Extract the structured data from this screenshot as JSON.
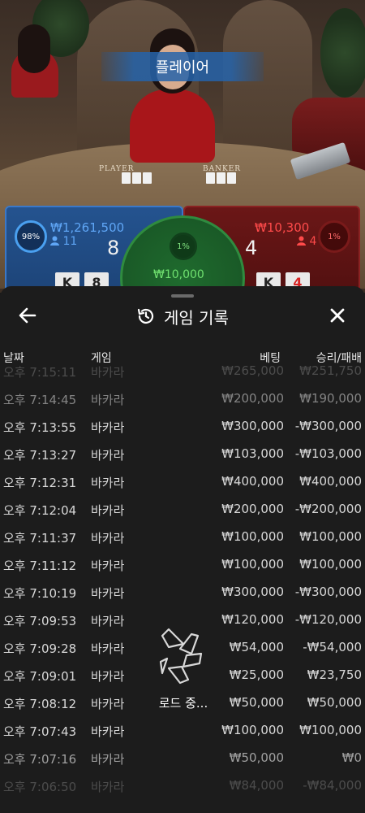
{
  "video": {
    "banner_label": "플레이어",
    "felt_player": "PLAYER",
    "felt_banker": "BANKER"
  },
  "bets": {
    "player": {
      "percent": "98%",
      "amount": "₩1,261,500",
      "players": "11",
      "score": "8",
      "cards": [
        "K",
        "8"
      ]
    },
    "banker": {
      "percent": "1%",
      "amount": "₩10,300",
      "players": "4",
      "score": "4",
      "cards": [
        "K",
        "4"
      ]
    },
    "tie": {
      "percent": "1%",
      "amount": "₩10,000"
    }
  },
  "history": {
    "title": "게임 기록",
    "columns": {
      "date": "날짜",
      "game": "게임",
      "bet": "베팅",
      "result": "승리/패배"
    },
    "rows": [
      {
        "date": "오후 7:15:11",
        "game": "바카라",
        "bet": "₩265,000",
        "result": "₩251,750"
      },
      {
        "date": "오후 7:14:45",
        "game": "바카라",
        "bet": "₩200,000",
        "result": "₩190,000"
      },
      {
        "date": "오후 7:13:55",
        "game": "바카라",
        "bet": "₩300,000",
        "result": "-₩300,000"
      },
      {
        "date": "오후 7:13:27",
        "game": "바카라",
        "bet": "₩103,000",
        "result": "-₩103,000"
      },
      {
        "date": "오후 7:12:31",
        "game": "바카라",
        "bet": "₩400,000",
        "result": "₩400,000"
      },
      {
        "date": "오후 7:12:04",
        "game": "바카라",
        "bet": "₩200,000",
        "result": "-₩200,000"
      },
      {
        "date": "오후 7:11:37",
        "game": "바카라",
        "bet": "₩100,000",
        "result": "₩100,000"
      },
      {
        "date": "오후 7:11:12",
        "game": "바카라",
        "bet": "₩100,000",
        "result": "₩100,000"
      },
      {
        "date": "오후 7:10:19",
        "game": "바카라",
        "bet": "₩300,000",
        "result": "-₩300,000"
      },
      {
        "date": "오후 7:09:53",
        "game": "바카라",
        "bet": "₩120,000",
        "result": "-₩120,000"
      },
      {
        "date": "오후 7:09:28",
        "game": "바카라",
        "bet": "₩54,000",
        "result": "-₩54,000"
      },
      {
        "date": "오후 7:09:01",
        "game": "바카라",
        "bet": "₩25,000",
        "result": "₩23,750"
      },
      {
        "date": "오후 7:08:12",
        "game": "바카라",
        "bet": "₩50,000",
        "result": "₩50,000"
      },
      {
        "date": "오후 7:07:43",
        "game": "바카라",
        "bet": "₩100,000",
        "result": "₩100,000"
      },
      {
        "date": "오후 7:07:16",
        "game": "바카라",
        "bet": "₩50,000",
        "result": "₩0"
      },
      {
        "date": "오후 7:06:50",
        "game": "바카라",
        "bet": "₩84,000",
        "result": "-₩84,000"
      }
    ],
    "loading_text": "로드 중..."
  },
  "icons": {
    "back": "arrow-left-icon",
    "close": "close-icon",
    "history": "history-icon",
    "user": "user-icon",
    "loader": "loading-spinner-icon"
  },
  "colors": {
    "player_blue": "#5fa6f6",
    "banker_red": "#ff4a4a",
    "tie_green": "#6fe06f",
    "sheet_bg": "#1c1c1c"
  }
}
